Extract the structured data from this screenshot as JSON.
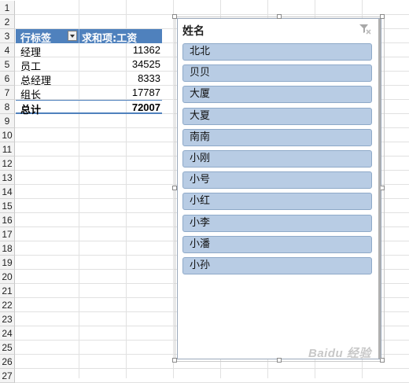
{
  "row_numbers": [
    "1",
    "2",
    "3",
    "4",
    "5",
    "6",
    "7",
    "8",
    "9",
    "10",
    "11",
    "12",
    "13",
    "14",
    "15",
    "16",
    "17",
    "18",
    "19",
    "20",
    "21",
    "22",
    "23",
    "24",
    "25",
    "26",
    "27"
  ],
  "pivot": {
    "header_row_label": "行标签",
    "header_sum_label": "求和项:工资",
    "rows": [
      {
        "label": "经理",
        "value": "11362"
      },
      {
        "label": "员工",
        "value": "34525"
      },
      {
        "label": "总经理",
        "value": "8333"
      },
      {
        "label": "组长",
        "value": "17787"
      }
    ],
    "total_label": "总计",
    "total_value": "72007"
  },
  "slicer": {
    "title": "姓名",
    "items": [
      "北北",
      "贝贝",
      "大厦",
      "大夏",
      "南南",
      "小刚",
      "小号",
      "小红",
      "小李",
      "小潘",
      "小孙"
    ]
  },
  "watermark": "Baidu 经验",
  "colors": {
    "pivot_header": "#4f81bd",
    "slicer_item": "#b8cce4"
  }
}
